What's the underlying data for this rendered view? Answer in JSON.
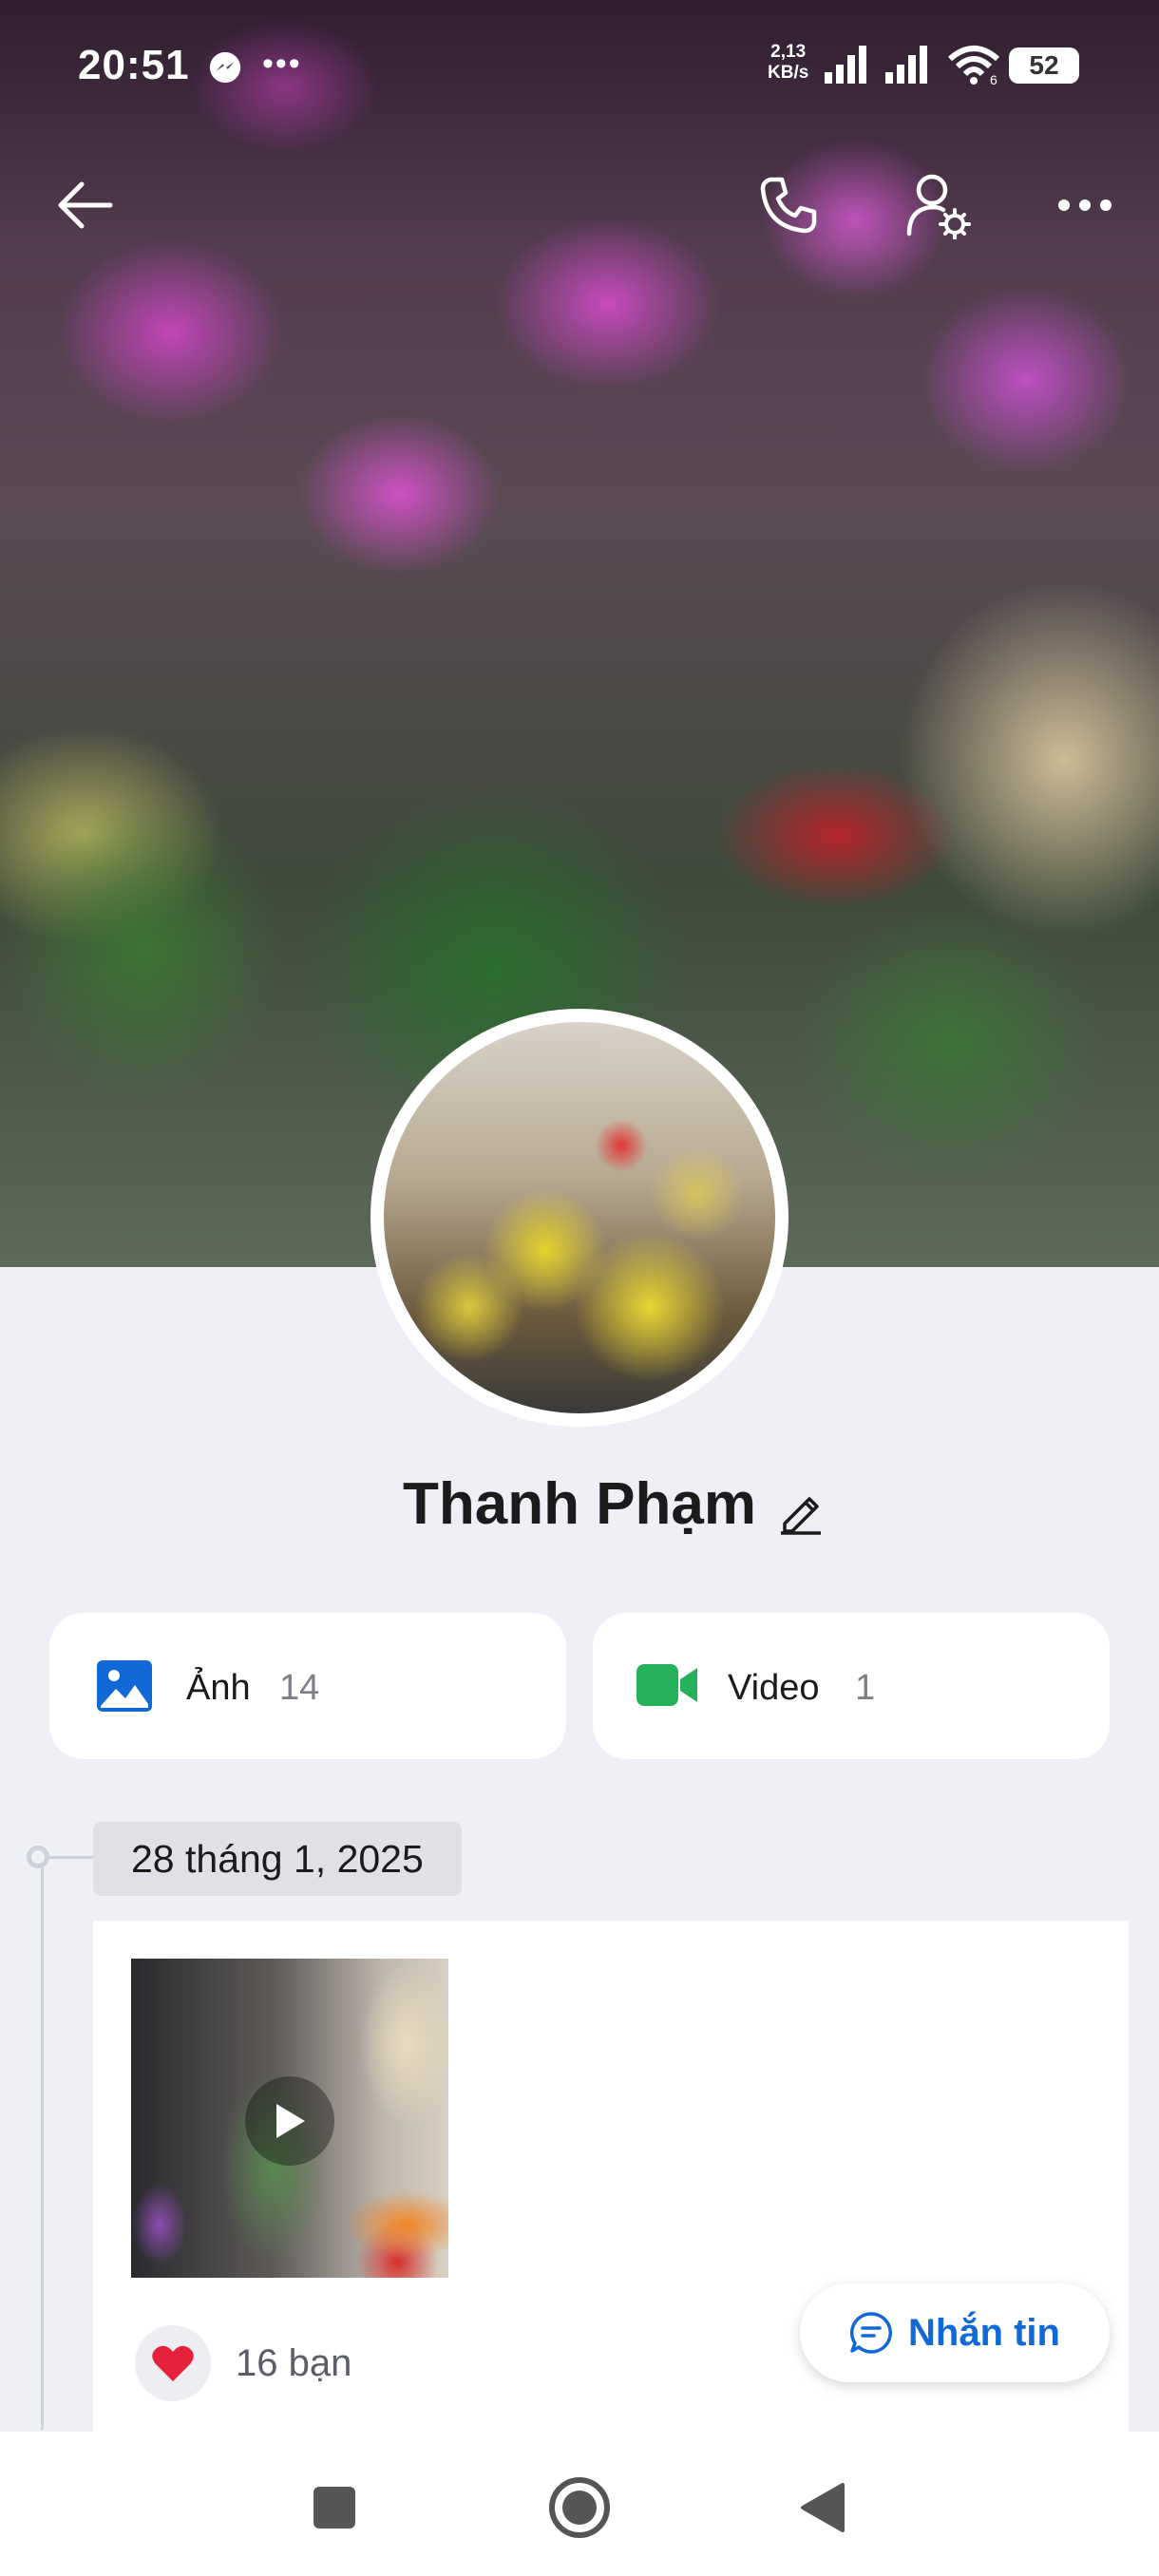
{
  "status_bar": {
    "time": "20:51",
    "overflow_dots": "•••",
    "net_speed_value": "2,13",
    "net_speed_unit": "KB/s",
    "wifi_label": "6",
    "battery": "52"
  },
  "top_bar": {
    "icons": [
      "back-arrow-icon",
      "phone-call-icon",
      "profile-settings-icon",
      "more-icon"
    ]
  },
  "profile": {
    "name": "Thanh Phạm"
  },
  "media_cards": [
    {
      "label": "Ảnh",
      "count": "14",
      "icon": "photo-icon",
      "color": "#1169d7"
    },
    {
      "label": "Video",
      "count": "1",
      "icon": "video-camera-icon",
      "color": "#27b15a"
    }
  ],
  "timeline": {
    "date": "28 tháng 1, 2025",
    "post": {
      "media_type": "video",
      "reaction_icon": "heart-icon",
      "reaction_count": "16 bạn"
    }
  },
  "message_button": {
    "label": "Nhắn tin",
    "color": "#1169d7"
  },
  "nav_bar": {
    "icons": [
      "recent-apps-icon",
      "home-icon",
      "back-icon"
    ]
  }
}
